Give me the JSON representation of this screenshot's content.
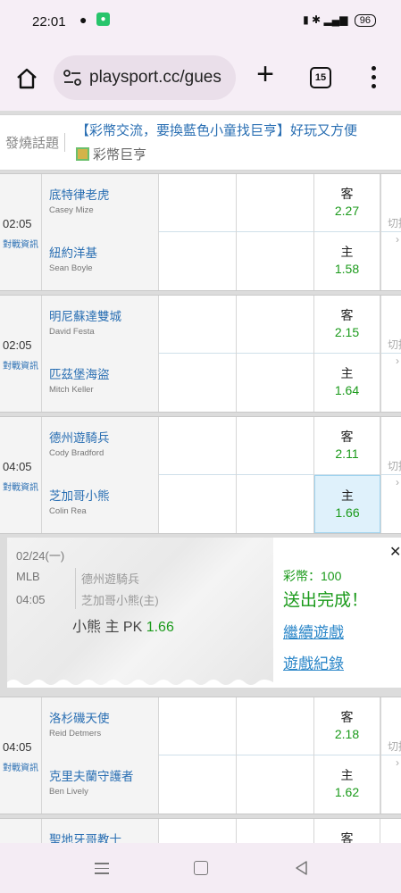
{
  "status": {
    "time": "22:01",
    "battery": "96"
  },
  "browser": {
    "url": "playsport.cc/gues",
    "tab_count": "15"
  },
  "topic": {
    "label": "發燒話題",
    "link": "【彩幣交流，要換藍色小童找巨亨】好玩又方便",
    "sub": "彩幣巨亨"
  },
  "games": [
    {
      "time": "02:05",
      "info": "對戰資訊",
      "away": {
        "team": "底特律老虎",
        "pitcher": "Casey Mize",
        "label": "客",
        "odds": "2.27"
      },
      "home": {
        "team": "紐約洋基",
        "pitcher": "Sean Boyle",
        "label": "主",
        "odds": "1.58"
      },
      "switch": "切換",
      "arrow": "›"
    },
    {
      "time": "02:05",
      "info": "對戰資訊",
      "away": {
        "team": "明尼蘇達雙城",
        "pitcher": "David Festa",
        "label": "客",
        "odds": "2.15"
      },
      "home": {
        "team": "匹茲堡海盜",
        "pitcher": "Mitch Keller",
        "label": "主",
        "odds": "1.64"
      },
      "switch": "切換",
      "arrow": "›"
    },
    {
      "time": "04:05",
      "info": "對戰資訊",
      "away": {
        "team": "德州遊騎兵",
        "pitcher": "Cody Bradford",
        "label": "客",
        "odds": "2.11"
      },
      "home": {
        "team": "芝加哥小熊",
        "pitcher": "Colin Rea",
        "label": "主",
        "odds": "1.66"
      },
      "switch": "切換",
      "arrow": "›"
    },
    {
      "time": "04:05",
      "info": "對戰資訊",
      "away": {
        "team": "洛杉磯天使",
        "pitcher": "Reid Detmers",
        "label": "客",
        "odds": "2.18"
      },
      "home": {
        "team": "克里夫蘭守護者",
        "pitcher": "Ben Lively",
        "label": "主",
        "odds": "1.62"
      },
      "switch": "切換",
      "arrow": "›"
    },
    {
      "time": "",
      "info": "",
      "away": {
        "team": "聖地牙哥教士",
        "pitcher": "",
        "label": "客",
        "odds": ""
      },
      "home": {
        "team": "",
        "pitcher": "",
        "label": "",
        "odds": ""
      },
      "switch": "",
      "arrow": ""
    }
  ],
  "popup": {
    "date": "02/24(一)",
    "league": "MLB",
    "time": "04:05",
    "team1": "德州遊騎兵",
    "team2": "芝加哥小熊(主)",
    "bet_text": "小熊 主 PK",
    "bet_odds": "1.66",
    "coins": "彩幣：100",
    "done": "送出完成！",
    "continue": "繼續遊戲",
    "history": "遊戲紀錄",
    "close": "✕"
  },
  "icons": [
    "home-icon",
    "tune-icon",
    "plus-icon",
    "tabs-icon",
    "menu-icon",
    "close-icon",
    "nav-menu-icon",
    "nav-home-icon",
    "nav-back-icon"
  ],
  "colors": {
    "link": "#2a6fb3",
    "odds": "#1a9a1a",
    "selected": "#dff1fb"
  }
}
